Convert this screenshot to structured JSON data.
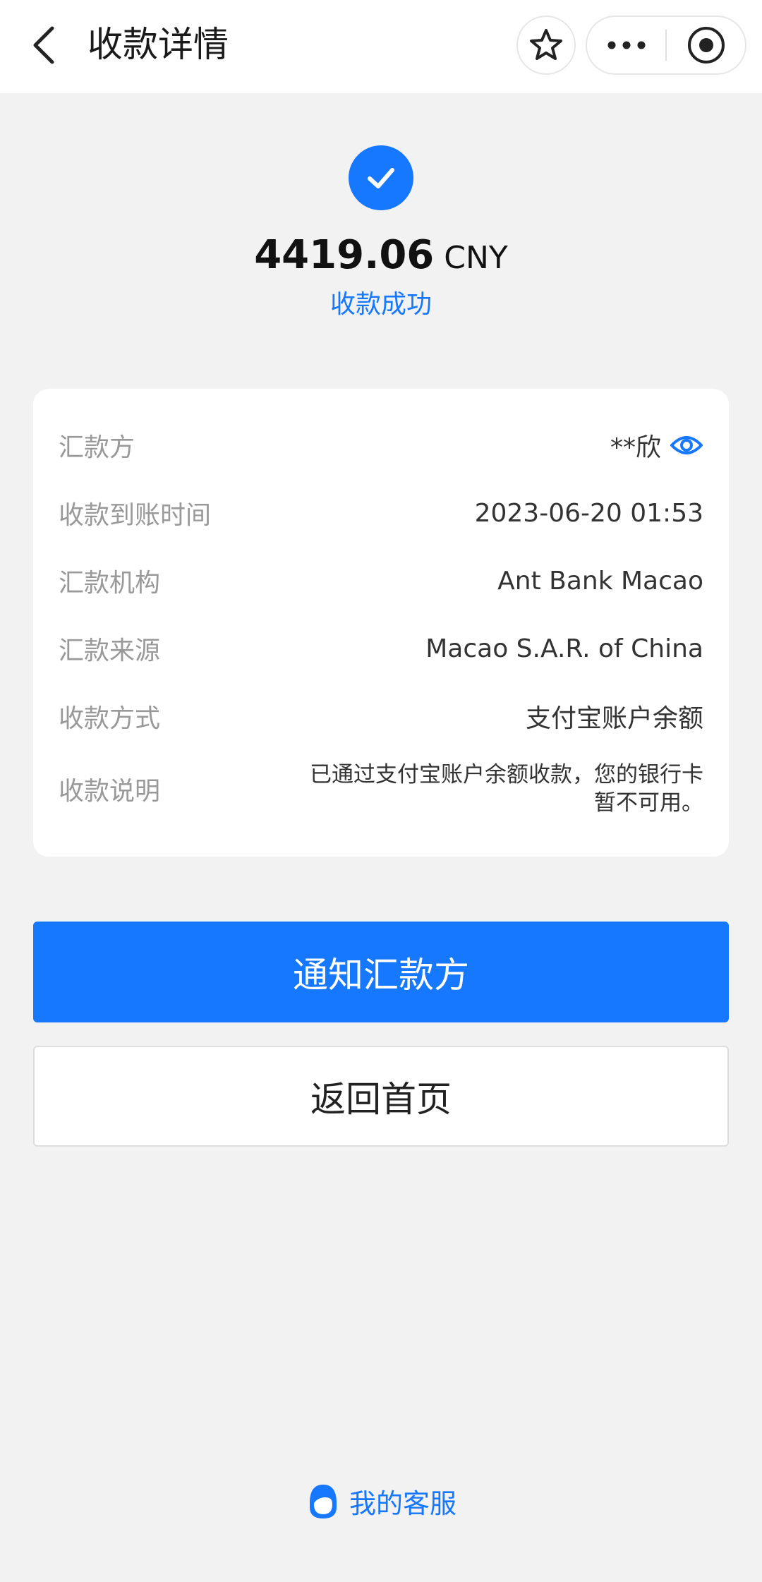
{
  "header": {
    "title": "收款详情",
    "icons": [
      "back-icon",
      "star-icon",
      "more-icon",
      "target-icon"
    ]
  },
  "result": {
    "amount": "4419.06",
    "currency": "CNY",
    "status": "收款成功",
    "icon": "check-circle-icon"
  },
  "details": {
    "rows": [
      {
        "label": "汇款方",
        "value": "**欣"
      },
      {
        "label": "收款到账时间",
        "value": "2023-06-20 01:53"
      },
      {
        "label": "汇款机构",
        "value": "Ant Bank Macao"
      },
      {
        "label": "汇款来源",
        "value": "Macao S.A.R. of China"
      },
      {
        "label": "收款方式",
        "value": "支付宝账户余额"
      },
      {
        "label": "收款说明",
        "value_line1": "已通过支付宝账户余额收款，您的银行卡",
        "value_line2": "暂不可用。"
      }
    ]
  },
  "actions": {
    "primary_label": "通知汇款方",
    "secondary_label": "返回首页"
  },
  "footer": {
    "service_label": "我的客服"
  },
  "colors": {
    "accent": "#1677ff",
    "background": "#f2f2f2",
    "card": "#ffffff",
    "label": "#999999"
  }
}
